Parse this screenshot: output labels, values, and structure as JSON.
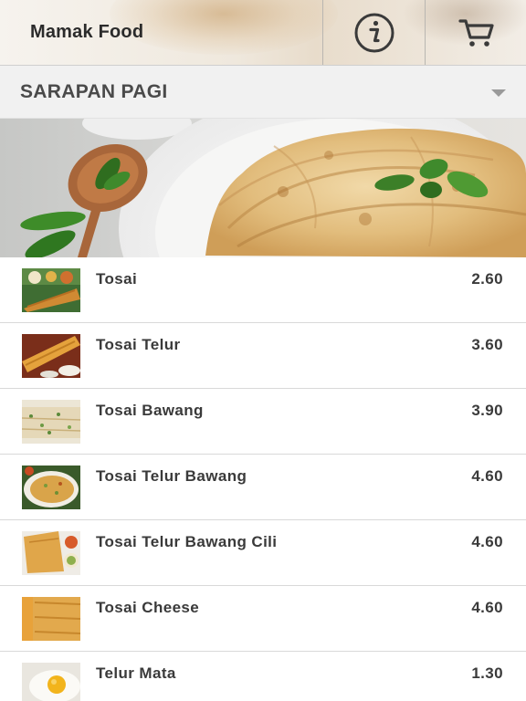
{
  "header": {
    "title": "Mamak Food",
    "info_icon": "info-icon",
    "cart_icon": "cart-icon"
  },
  "category": {
    "selected": "SARAPAN PAGI",
    "caret_icon": "chevron-down-icon"
  },
  "banner": {
    "description_icon": "roti-canai-banner-image"
  },
  "menu": {
    "items": [
      {
        "name": "Tosai",
        "price": "2.60"
      },
      {
        "name": "Tosai Telur",
        "price": "3.60"
      },
      {
        "name": "Tosai Bawang",
        "price": "3.90"
      },
      {
        "name": "Tosai Telur Bawang",
        "price": "4.60"
      },
      {
        "name": "Tosai Telur Bawang Cili",
        "price": "4.60"
      },
      {
        "name": "Tosai Cheese",
        "price": "4.60"
      },
      {
        "name": "Telur Mata",
        "price": "1.30"
      }
    ]
  },
  "colors": {
    "header_bg": "#f2ede6",
    "category_bg": "#f1f1f1",
    "text": "#3a3a3a",
    "divider": "#d9d9d9"
  }
}
